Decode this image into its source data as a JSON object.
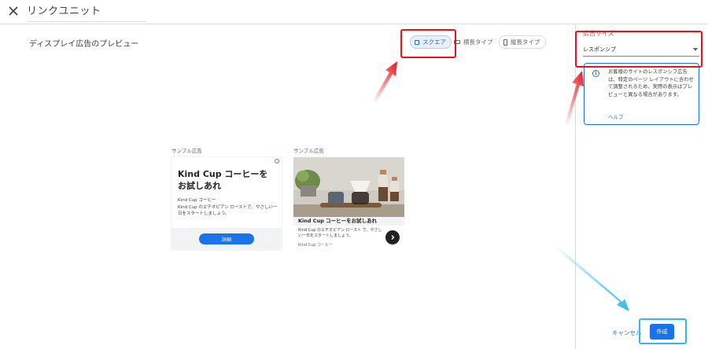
{
  "header": {
    "title": "リンクユニット",
    "close_icon": "close-icon"
  },
  "preview": {
    "title": "ディスプレイ広告のプレビュー",
    "types": [
      {
        "label": "スクエア",
        "icon": "square-icon",
        "active": true
      },
      {
        "label": "横長タイプ",
        "icon": "horizontal-rect-icon",
        "active": false
      },
      {
        "label": "縦長タイプ",
        "icon": "vertical-rect-icon",
        "active": false
      }
    ]
  },
  "ads": [
    {
      "caption": "サンプル広告",
      "headline": "Kind Cup コーヒーを お試しあれ",
      "brand": "Kind Cup コーヒー",
      "description": "Kind Cup のエチオピアン ローストで、やさしい一日をスタートしましょう。",
      "button": "詳細"
    },
    {
      "caption": "サンプル広告",
      "headline": "Kind Cup コーヒーをお試しあれ",
      "description": "Kind Cup のエチオピアン ロースト で、やさしい一日をスタートしましょう。",
      "brand": "Kind Cup コーヒー"
    }
  ],
  "sidebar": {
    "size_label": "広告サイズ",
    "size_value": "レスポンシブ",
    "info_text": "お客様のサイトのレスポンシブ広告は、特定のページ レイアウトに合わせて調整されるため、実際の表示はプレビューと異なる場合があります。",
    "help_link": "ヘルプ"
  },
  "footer": {
    "cancel": "キャンセル",
    "create": "作成"
  },
  "colors": {
    "accent": "#1a73e8",
    "annotation_red": "#e8141b",
    "annotation_blue": "#35b7e8"
  }
}
